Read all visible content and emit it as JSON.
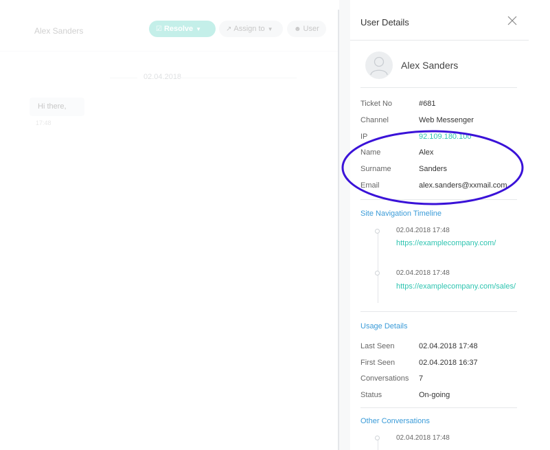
{
  "chat": {
    "user_name": "Alex Sanders",
    "resolve_label": "Resolve",
    "assign_label": "Assign to",
    "user_label": "User",
    "date": "02.04.2018",
    "message": "Hi there,",
    "message_time": "17:48"
  },
  "panel": {
    "title": "User Details",
    "profile_name": "Alex Sanders",
    "details": {
      "ticket_label": "Ticket No",
      "ticket_value": "#681",
      "channel_label": "Channel",
      "channel_value": "Web Messenger",
      "ip_label": "IP",
      "ip_value": "92.109.180.100",
      "name_label": "Name",
      "name_value": "Alex",
      "surname_label": "Surname",
      "surname_value": "Sanders",
      "email_label": "Email",
      "email_value": "alex.sanders@xxmail.com"
    },
    "timeline": {
      "title": "Site Navigation Timeline",
      "items": [
        {
          "time": "02.04.2018 17:48",
          "url": "https://examplecompany.com/"
        },
        {
          "time": "02.04.2018 17:48",
          "url": "https://examplecompany.com/sales/"
        }
      ]
    },
    "usage": {
      "title": "Usage Details",
      "last_seen_label": "Last Seen",
      "last_seen_value": "02.04.2018 17:48",
      "first_seen_label": "First Seen",
      "first_seen_value": "02.04.2018 16:37",
      "conversations_label": "Conversations",
      "conversations_value": "7",
      "status_label": "Status",
      "status_value": "On-going"
    },
    "other": {
      "title": "Other Conversations",
      "first_time": "02.04.2018 17:48"
    }
  },
  "colors": {
    "accent": "#2ec4b0",
    "section_title": "#3a9bd8",
    "highlight": "#3a12d8"
  }
}
